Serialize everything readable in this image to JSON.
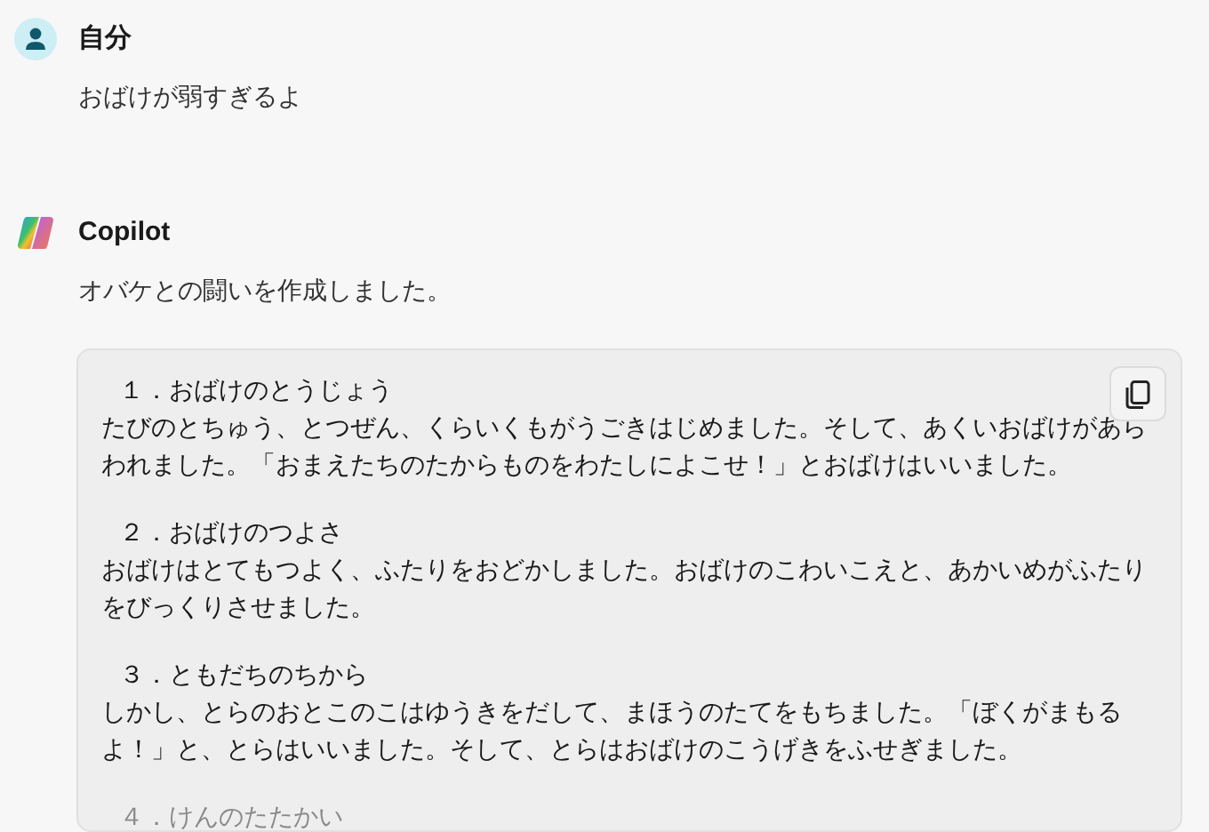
{
  "messages": [
    {
      "kind": "user",
      "author": "自分",
      "text": "おばけが弱すぎるよ"
    },
    {
      "kind": "copilot",
      "author": "Copilot",
      "text": "オバケとの闘いを作成しました。",
      "code_block": {
        "sections": [
          {
            "heading": "１．おばけのとうじょう",
            "body": "たびのとちゅう、とつぜん、くらいくもがうごきはじめました。そして、あくいおばけがあらわれました。「おまえたちのたからものをわたしによこせ！」とおばけはいいました。",
            "faded": false
          },
          {
            "heading": "２．おばけのつよさ",
            "body": "おばけはとてもつよく、ふたりをおどかしました。おばけのこわいこえと、あかいめがふたりをびっくりさせました。",
            "faded": false
          },
          {
            "heading": "３．ともだちのちから",
            "body": "しかし、とらのおとこのこはゆうきをだして、まほうのたてをもちました。「ぼくがまもるよ！」と、とらはいいました。そして、とらはおばけのこうげきをふせぎました。",
            "faded": false
          },
          {
            "heading": "４．けんのたたかい",
            "faded": true
          }
        ]
      }
    }
  ]
}
